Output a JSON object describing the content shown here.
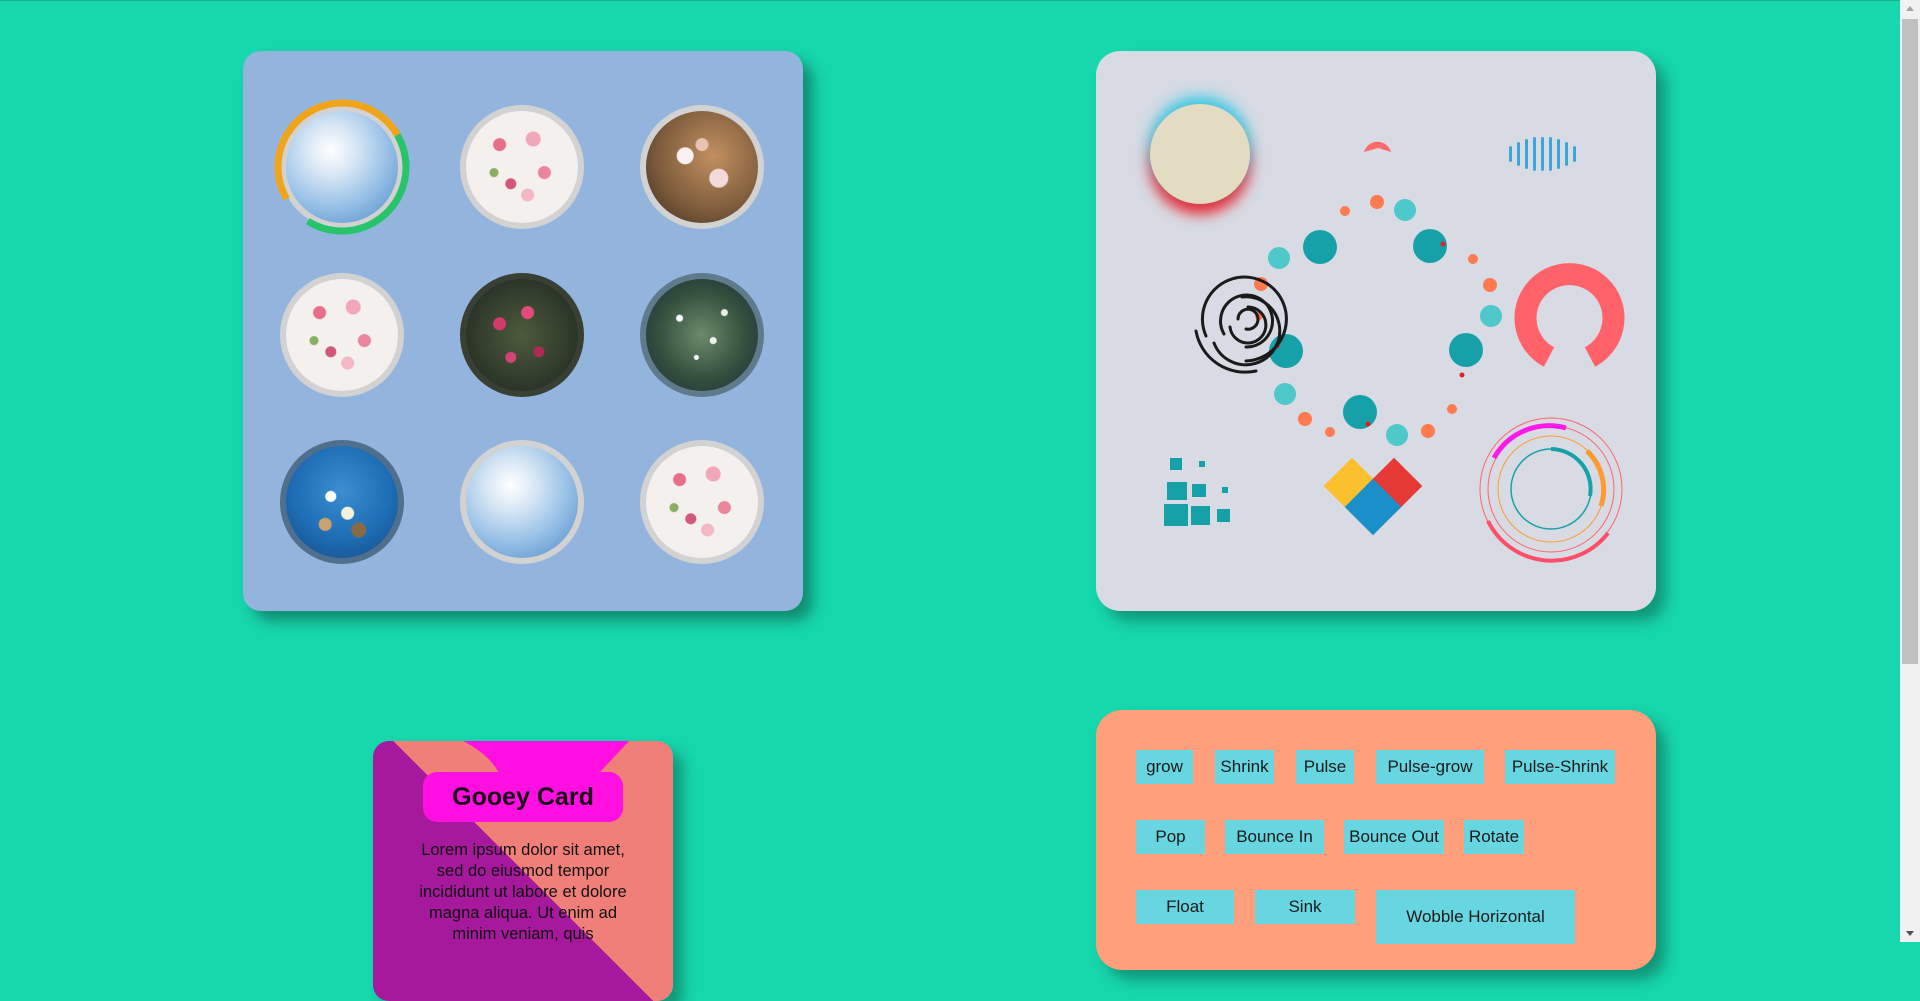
{
  "image_grid": {
    "items": [
      {
        "kind": "forget-me-not blue flowers",
        "style": "img-blue",
        "ring": true
      },
      {
        "kind": "pink blossom branch",
        "style": "img-blossom",
        "ring": false
      },
      {
        "kind": "cherry blossom warm",
        "style": "img-cherry-dark",
        "ring": false
      },
      {
        "kind": "pink blossom branch",
        "style": "img-blossom",
        "ring": false
      },
      {
        "kind": "red buds dark green",
        "style": "img-darkgreen",
        "ring": false
      },
      {
        "kind": "white blossoms night",
        "style": "img-night",
        "ring": false
      },
      {
        "kind": "blossoms blue sky",
        "style": "img-bluesky",
        "ring": false
      },
      {
        "kind": "forget-me-not blue flowers",
        "style": "img-blue",
        "ring": false
      },
      {
        "kind": "pink blossom branch",
        "style": "img-blossom",
        "ring": false
      }
    ],
    "ring_colors": [
      "#f0a41a",
      "#27c46b"
    ]
  },
  "loaders": {
    "colors": {
      "teal": "#16a1a8",
      "light_teal": "#4fc8cc",
      "orange": "#ff7a4f",
      "red_ring": "#ff6369",
      "blue_bars": "#3aa6dc",
      "heart_yellow": "#fbc02d",
      "heart_red": "#e53935",
      "heart_blue": "#1b8fc9",
      "magenta": "#ff19e6"
    }
  },
  "gooey_card": {
    "title": "Gooey Card",
    "text": "Lorem ipsum dolor sit amet, sed do eiusmod tempor incididunt ut labore et dolore magna aliqua. Ut enim ad minim veniam, quis"
  },
  "hover_buttons": {
    "row1": [
      "grow",
      "Shrink",
      "Pulse",
      "Pulse-grow",
      "Pulse-Shrink"
    ],
    "row2": [
      "Pop",
      "Bounce In",
      "Bounce Out",
      "Rotate"
    ],
    "row3": [
      "Float",
      "Sink",
      "Wobble Horizontal"
    ]
  }
}
